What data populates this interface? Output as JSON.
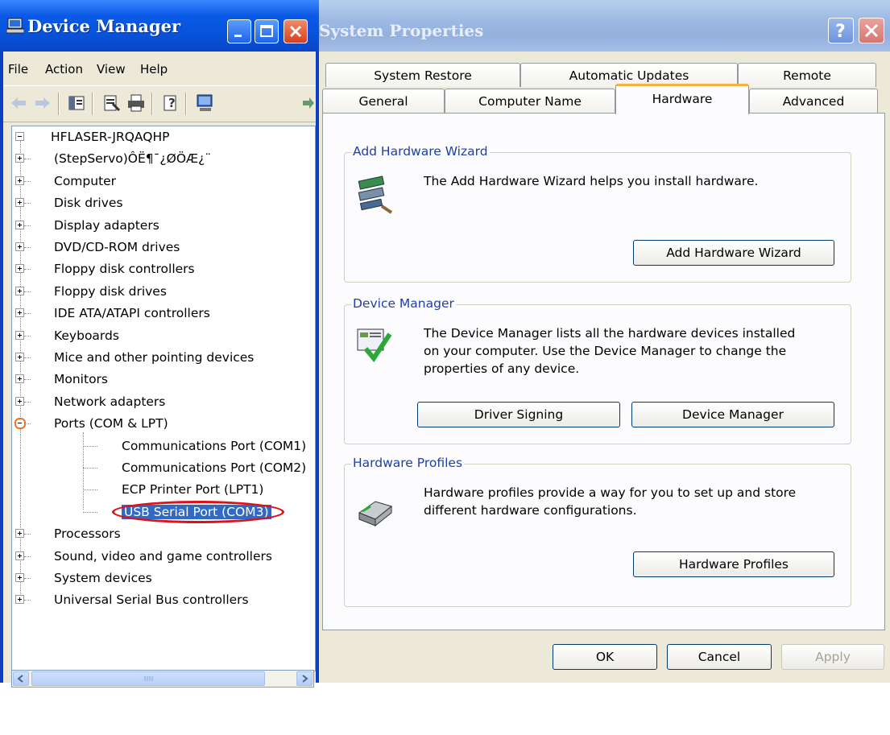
{
  "device_manager": {
    "title": "Device Manager",
    "menu": [
      "File",
      "Action",
      "View",
      "Help"
    ],
    "toolbar_icons": [
      "back-arrow-icon",
      "forward-arrow-icon",
      "show-hide-console-tree-icon",
      "properties-icon",
      "print-icon",
      "help-icon",
      "scan-hardware-icon"
    ],
    "tree": {
      "root": "HFLASER-JRQAQHP",
      "items": [
        {
          "label": "(StepServo)ÔË¶¯¿ØÖÆ¿¨",
          "expander": "plus",
          "icon": "network-card-icon"
        },
        {
          "label": "Computer",
          "expander": "plus",
          "icon": "computer-icon"
        },
        {
          "label": "Disk drives",
          "expander": "plus",
          "icon": "disk-drive-icon"
        },
        {
          "label": "Display adapters",
          "expander": "plus",
          "icon": "display-adapter-icon"
        },
        {
          "label": "DVD/CD-ROM drives",
          "expander": "plus",
          "icon": "cdrom-icon"
        },
        {
          "label": "Floppy disk controllers",
          "expander": "plus",
          "icon": "floppy-controller-icon"
        },
        {
          "label": "Floppy disk drives",
          "expander": "plus",
          "icon": "floppy-drive-icon"
        },
        {
          "label": "IDE ATA/ATAPI controllers",
          "expander": "plus",
          "icon": "ide-controller-icon"
        },
        {
          "label": "Keyboards",
          "expander": "plus",
          "icon": "keyboard-icon"
        },
        {
          "label": "Mice and other pointing devices",
          "expander": "plus",
          "icon": "mouse-icon"
        },
        {
          "label": "Monitors",
          "expander": "plus",
          "icon": "monitor-icon"
        },
        {
          "label": "Network adapters",
          "expander": "plus",
          "icon": "network-adapter-icon"
        },
        {
          "label": "Ports (COM & LPT)",
          "expander": "minus",
          "icon": "port-icon"
        },
        {
          "label": "Communications Port (COM1)",
          "child": true,
          "icon": "port-icon"
        },
        {
          "label": "Communications Port (COM2)",
          "child": true,
          "icon": "port-icon"
        },
        {
          "label": "ECP Printer Port (LPT1)",
          "child": true,
          "icon": "port-icon"
        },
        {
          "label": "USB Serial Port (COM3)",
          "child": true,
          "icon": "port-icon",
          "selected": true
        },
        {
          "label": "Processors",
          "expander": "plus",
          "icon": "processor-icon"
        },
        {
          "label": "Sound, video and game controllers",
          "expander": "plus",
          "icon": "sound-icon"
        },
        {
          "label": "System devices",
          "expander": "plus",
          "icon": "system-devices-icon"
        },
        {
          "label": "Universal Serial Bus controllers",
          "expander": "plus",
          "icon": "usb-icon"
        }
      ]
    }
  },
  "system_properties": {
    "title": "System Properties",
    "tabs_back": [
      "System Restore",
      "Automatic Updates",
      "Remote"
    ],
    "tabs_front": [
      "General",
      "Computer Name",
      "Hardware",
      "Advanced"
    ],
    "active_tab": "Hardware",
    "groups": {
      "add_hardware": {
        "title": "Add Hardware Wizard",
        "text": "The Add Hardware Wizard helps you install hardware.",
        "button": "Add Hardware Wizard"
      },
      "device_manager": {
        "title": "Device Manager",
        "text_lines": [
          "The Device Manager lists all the hardware devices installed",
          "on your computer. Use the Device Manager to change the",
          "properties of any device."
        ],
        "buttons": [
          "Driver Signing",
          "Device Manager"
        ]
      },
      "hardware_profiles": {
        "title": "Hardware Profiles",
        "text_lines": [
          "Hardware profiles provide a way for you to set up and store",
          "different hardware configurations."
        ],
        "button": "Hardware Profiles"
      }
    },
    "footer_buttons": [
      "OK",
      "Cancel",
      "Apply"
    ]
  },
  "colors": {
    "xp_titlebar_blue": "#0a5ae6",
    "selection_blue": "#316ac5",
    "annotation_red": "#e0101a",
    "annotation_orange": "#f07020"
  }
}
